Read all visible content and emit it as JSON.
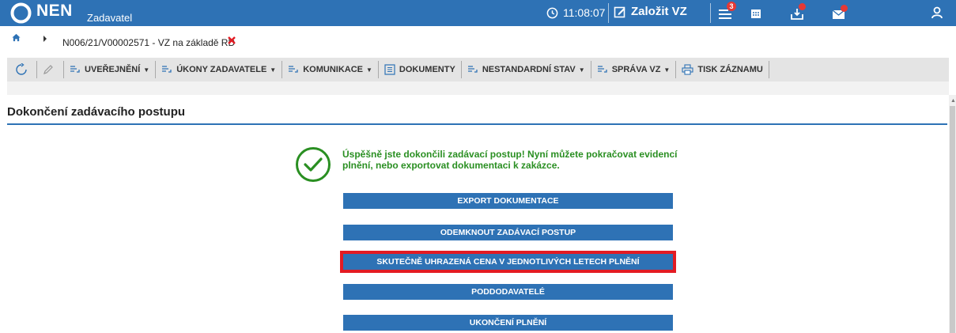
{
  "header": {
    "brand": "NEN",
    "brand_sub": "Zadavatel",
    "time": "11:08:07",
    "create_label": "Založit VZ",
    "menu_badge": "3"
  },
  "breadcrumb": {
    "text": "N006/21/V00002571 - VZ na základě RD"
  },
  "toolbar": {
    "items": [
      {
        "label": "UVEŘEJNĚNÍ",
        "dropdown": true
      },
      {
        "label": "ÚKONY ZADAVATELE",
        "dropdown": true
      },
      {
        "label": "KOMUNIKACE",
        "dropdown": true
      },
      {
        "label": "DOKUMENTY",
        "dropdown": false
      },
      {
        "label": "NESTANDARDNÍ STAV",
        "dropdown": true
      },
      {
        "label": "SPRÁVA VZ",
        "dropdown": true
      },
      {
        "label": "TISK ZÁZNAMU",
        "dropdown": false
      }
    ]
  },
  "main": {
    "title": "Dokončení zadávacího postupu",
    "success_message": "Úspěšně jste dokončili zadávací postup! Nyní můžete pokračovat evidencí plnění, nebo exportovat dokumentaci k zakázce.",
    "actions": [
      {
        "label": "EXPORT DOKUMENTACE"
      },
      {
        "label": "ODEMKNOUT ZADÁVACÍ POSTUP"
      },
      {
        "label": "SKUTEČNĚ UHRAZENÁ CENA V JEDNOTLIVÝCH LETECH PLNĚNÍ",
        "highlighted": true
      },
      {
        "label": "PODDODAVATELÉ"
      },
      {
        "label": "UKONČENÍ PLNĚNÍ"
      }
    ]
  },
  "colors": {
    "primary": "#2e72b5",
    "success": "#2a8f22",
    "highlight": "#e31b23",
    "badge": "#e53935"
  }
}
